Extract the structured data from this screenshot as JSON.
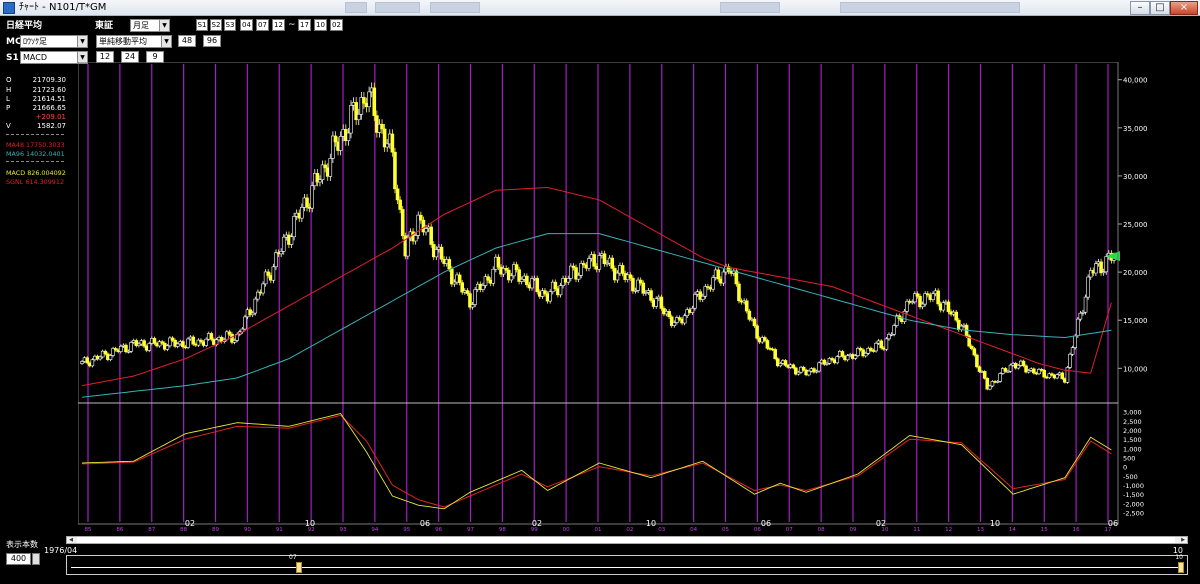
{
  "window": {
    "title": "ﾁｬｰﾄ - N101/T*GM",
    "controls": [
      "–",
      "□",
      "×"
    ]
  },
  "toolbar": {
    "index_name": "日経平均",
    "exchange": "東証",
    "period": "月足",
    "series_buttons": [
      "S1",
      "S2",
      "S3"
    ],
    "from_date": [
      "04",
      "07",
      "12"
    ],
    "to_date": [
      "17",
      "10",
      "02"
    ],
    "tilde": "~",
    "mc_label": "MC",
    "mc_chart_type": "ﾛｳｿｸ足",
    "ma_type": "単純移動平均",
    "ma_periods": [
      "48",
      "96"
    ],
    "s1_label": "S1",
    "s1_indicator": "MACD",
    "macd_params": [
      "12",
      "24",
      "9"
    ]
  },
  "info": {
    "ohlc": [
      {
        "k": "O",
        "v": "21709.30"
      },
      {
        "k": "H",
        "v": "21723.60"
      },
      {
        "k": "L",
        "v": "21614.51"
      },
      {
        "k": "P",
        "v": "21666.65"
      },
      {
        "k": "",
        "v": "+209.01"
      },
      {
        "k": "V",
        "v": "1582.07"
      }
    ],
    "ma48": "MA48  17750.3033",
    "ma96": "MA96  14032.0401",
    "macd": "MACD  826.004092",
    "signal": "SGNL  614.309912"
  },
  "colors": {
    "candle_up": "#ffffff",
    "candle_down": "#ffff33",
    "ma48": "#e0202a",
    "ma96": "#37b3b8",
    "macd": "#e8e83a",
    "signal": "#e02424",
    "vline": "#a020c0",
    "change": "#ff4444",
    "marker": "#22dd44"
  },
  "bottom": {
    "count_label": "表示本数",
    "count": "400",
    "start_label": "1976/04",
    "marker_mid": "07",
    "marker_end": "10",
    "marker_end2": "10"
  },
  "chart_data": [
    {
      "type": "line",
      "title": "",
      "axis": {
        "y_ticks": [
          "40,000",
          "35,000",
          "30,000",
          "25,000",
          "20,000",
          "15,000",
          "10,000"
        ],
        "ylim": [
          6500,
          40800
        ]
      },
      "x_labels": [
        "02",
        "10",
        "06",
        "02",
        "10",
        "06",
        "02",
        "10",
        "06"
      ],
      "x_small_labels": [
        "85",
        "86",
        "87",
        "88",
        "89",
        "90",
        "91",
        "92",
        "93",
        "94",
        "95",
        "96",
        "97",
        "98",
        "99",
        "00",
        "01",
        "02",
        "03",
        "04",
        "05",
        "06",
        "07",
        "08",
        "09",
        "10",
        "11",
        "12",
        "13",
        "14",
        "15",
        "16",
        "17"
      ],
      "series": [
        {
          "name": "MA48",
          "x": [
            0,
            20,
            40,
            60,
            80,
            100,
            120,
            140,
            160,
            180,
            200,
            210,
            220,
            230,
            240,
            250,
            260,
            270,
            280,
            290,
            300,
            310,
            320,
            330,
            340,
            350,
            360,
            370,
            380,
            390,
            399
          ],
          "values": [
            8200,
            9200,
            11000,
            13500,
            16500,
            19500,
            22500,
            26000,
            28500,
            28800,
            27500,
            26000,
            24500,
            23000,
            21500,
            20500,
            20000,
            19500,
            19000,
            18500,
            17500,
            16500,
            15500,
            14500,
            13500,
            12500,
            11500,
            10500,
            9800,
            9500,
            17750
          ]
        },
        {
          "name": "MA96",
          "x": [
            0,
            20,
            40,
            60,
            80,
            100,
            120,
            140,
            160,
            180,
            200,
            220,
            240,
            260,
            280,
            300,
            320,
            340,
            360,
            380,
            399
          ],
          "values": [
            7000,
            7600,
            8200,
            9000,
            11000,
            14000,
            17000,
            20000,
            22500,
            24000,
            24000,
            22500,
            21000,
            19500,
            18000,
            16500,
            15000,
            14000,
            13500,
            13200,
            14000
          ]
        },
        {
          "name": "price_path",
          "x": [
            0,
            20,
            40,
            60,
            80,
            100,
            110,
            120,
            125,
            130,
            140,
            150,
            160,
            170,
            180,
            190,
            200,
            210,
            220,
            230,
            240,
            250,
            260,
            270,
            280,
            290,
            300,
            310,
            320,
            330,
            340,
            350,
            360,
            370,
            380,
            390,
            399
          ],
          "values": [
            10500,
            12500,
            12600,
            13300,
            24000,
            34000,
            38500,
            32000,
            22000,
            25500,
            21000,
            17000,
            20500,
            19500,
            17500,
            20000,
            21500,
            19500,
            17500,
            14500,
            18000,
            20500,
            14000,
            10500,
            9500,
            11000,
            11500,
            12500,
            17000,
            17500,
            14500,
            8000,
            10500,
            9500,
            9000,
            20000,
            21666
          ]
        }
      ]
    },
    {
      "type": "line",
      "title": "",
      "axis": {
        "y_ticks": [
          "3,000",
          "2,500",
          "2,000",
          "1,500",
          "1,000",
          "500",
          "0",
          "-500",
          "-1,000",
          "-1,500",
          "-2,000",
          "-2,500"
        ],
        "ylim": [
          -2800,
          3200
        ]
      },
      "series": [
        {
          "name": "MACD",
          "x": [
            0,
            20,
            40,
            60,
            80,
            100,
            110,
            120,
            130,
            140,
            150,
            160,
            170,
            180,
            200,
            220,
            240,
            260,
            270,
            280,
            300,
            320,
            340,
            360,
            380,
            390,
            399
          ],
          "values": [
            200,
            300,
            1800,
            2400,
            2200,
            2900,
            800,
            -1600,
            -2100,
            -2300,
            -1400,
            -800,
            -200,
            -1300,
            200,
            -600,
            300,
            -1500,
            -900,
            -1400,
            -400,
            1700,
            1200,
            -1500,
            -600,
            1600,
            826
          ]
        },
        {
          "name": "SGNL",
          "x": [
            0,
            20,
            40,
            60,
            80,
            100,
            110,
            120,
            130,
            140,
            150,
            160,
            170,
            180,
            200,
            220,
            240,
            260,
            270,
            280,
            300,
            320,
            340,
            360,
            380,
            390,
            399
          ],
          "values": [
            150,
            250,
            1500,
            2200,
            2100,
            2800,
            1400,
            -1000,
            -1800,
            -2200,
            -1600,
            -1000,
            -400,
            -1100,
            0,
            -500,
            200,
            -1300,
            -1000,
            -1300,
            -500,
            1500,
            1300,
            -1200,
            -700,
            1400,
            614
          ]
        }
      ]
    }
  ]
}
